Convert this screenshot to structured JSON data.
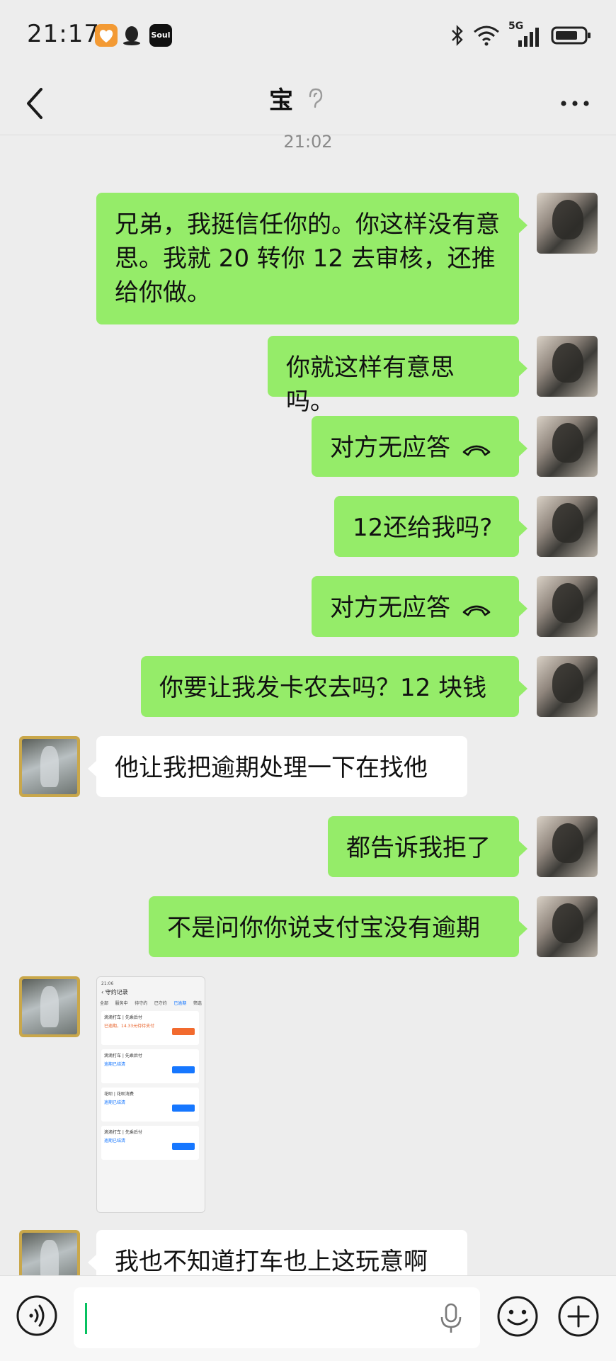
{
  "status_bar": {
    "time": "21:17",
    "soul_label": "Soul",
    "network": "5G"
  },
  "header": {
    "title": "宝"
  },
  "timestamp": "21:02",
  "messages": [
    {
      "side": "me",
      "text": "兄弟，我挺信任你的。你这样没有意思。我就 20 转你 12 去审核，还推给你做。"
    },
    {
      "side": "me",
      "text": "你就这样有意思吗。"
    },
    {
      "side": "me",
      "text": "对方无应答",
      "type": "call"
    },
    {
      "side": "me",
      "text": "12还给我吗?"
    },
    {
      "side": "me",
      "text": "对方无应答",
      "type": "call"
    },
    {
      "side": "me",
      "text": "你要让我发卡农去吗？12 块钱"
    },
    {
      "side": "them",
      "text": "他让我把逾期处理一下在找他"
    },
    {
      "side": "me",
      "text": "都告诉我拒了"
    },
    {
      "side": "me",
      "text": "不是问你你说支付宝没有逾期"
    },
    {
      "side": "them",
      "type": "image"
    },
    {
      "side": "them",
      "text": "我也不知道打车也上这玩意啊"
    }
  ],
  "thumbnail": {
    "header": "守约记录",
    "tabs": [
      "全部",
      "服务中",
      "待守约",
      "已守约",
      "已逾期",
      "筛选"
    ],
    "cards": [
      {
        "title": "滴滴打车 | 先乘后付",
        "line": "已逾期，14.33元待待支付",
        "button": "去支付"
      },
      {
        "title": "滴滴打车 | 先乘后付",
        "line": "逾期已结清",
        "button": "去查看"
      },
      {
        "title": "花呗 | 花呗消费",
        "line": "逾期已结清",
        "button": "去查看"
      },
      {
        "title": "滴滴打车 | 先乘后付",
        "line": "逾期已结清",
        "button": "去查看"
      }
    ]
  },
  "colors": {
    "bubble_me": "#95ec69",
    "bubble_them": "#ffffff",
    "background": "#ededed",
    "accent": "#07c160"
  }
}
